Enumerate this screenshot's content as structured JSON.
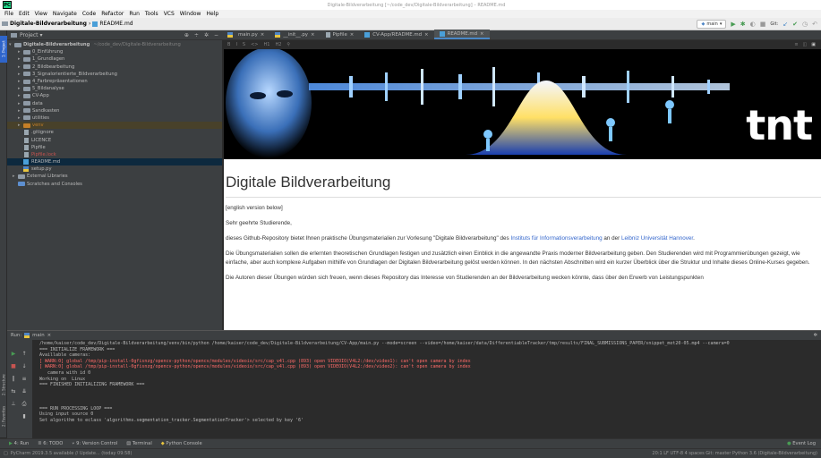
{
  "window": {
    "title": "Digitale-Bildverarbeitung [~/code_dev/Digitale-Bildverarbeitung] – README.md"
  },
  "menu": [
    "File",
    "Edit",
    "View",
    "Navigate",
    "Code",
    "Refactor",
    "Run",
    "Tools",
    "VCS",
    "Window",
    "Help"
  ],
  "nav": {
    "project": "Digitale-Bildverarbeitung",
    "file": "README.md",
    "branch": "main",
    "git_label": "Git:"
  },
  "project_panel": {
    "title": "Project",
    "root": "Digitale-Bildverarbeitung",
    "root_path": "~/code_dev/Digitale-Bildverarbeitung",
    "items": [
      "0_Einführung",
      "1_Grundlagen",
      "2_Bildbearbeitung",
      "3_Signalorientierte_Bildverarbeitung",
      "4_Farbrepräsentationen",
      "5_Bildanalyse",
      "CV-App",
      "data",
      "Sandkasten",
      "utilities",
      "venv",
      ".gitignore",
      "LICENCE",
      "Pipfile",
      "Pipfile.lock",
      "README.md",
      "setup.py",
      "External Libraries",
      "Scratches and Consoles"
    ]
  },
  "tabs": [
    "main.py",
    "__init__.py",
    "Pipfile",
    "CV-App/README.md",
    "README.md"
  ],
  "mdtools": [
    "B",
    "I",
    "S",
    "<>",
    "H1",
    "H2"
  ],
  "sidebar_tabs": [
    "1: Project",
    "2: Structure",
    "2: Favorites"
  ],
  "readme": {
    "heading": "Digitale Bildverarbeitung",
    "p1": "[english version below]",
    "p2": "Sehr geehrte Studierende,",
    "p3a": "dieses Github-Repository bietet Ihnen praktische Übungsmaterialien zur Vorlesung \"Digitale Bildverarbeitung\" des ",
    "p3link1": "Instituts für Informationsverarbeitung",
    "p3b": " an der ",
    "p3link2": "Leibniz Universität Hannover",
    "p3c": ".",
    "p4": "Die Übungsmaterialien sollen die erlernten theoretischen Grundlagen festigen und zusätzlich einen Einblick in die angewandte Praxis moderner Bildverarbeitung geben. Den Studierenden wird mit Programmierübungen gezeigt, wie einfache, aber auch komplexe Aufgaben mithilfe von Grundlagen der Digitalen Bildverarbeitung gelöst werden können. In den nächsten Abschnitten wird ein kurzer Überblick über die Struktur und Inhalte dieses Online-Kurses gegeben.",
    "p5": "Die Autoren dieser Übungen würden sich freuen, wenn dieses Repository das Interesse von Studierenden an der Bildverarbeitung wecken könnte, dass über den Erwerb von Leistungspunkten",
    "banner_logo": "tnt"
  },
  "run": {
    "label": "Run:",
    "config": "main",
    "lines": [
      {
        "t": "/home/kaiser/code_dev/Digitale-Bildverarbeitung/venv/bin/python /home/kaiser/code_dev/Digitale-Bildverarbeitung/CV-App/main.py --mode=screen --video=/home/kaiser/data/DifferentiableTracker/tmp/results/FINAL_SUBMISSIONS_PAPER/snippet_mot20-05.mp4 --camera=0",
        "e": false
      },
      {
        "t": "=== INITIALIZE FRAMEWORK ===",
        "e": false
      },
      {
        "t": "Availlable cameras:",
        "e": false
      },
      {
        "t": "[ WARN:0] global /tmp/pip-install-0gfisnzg/opencv-python/opencv/modules/videoio/src/cap_v4l.cpp (893) open VIDEOIO(V4L2:/dev/video1): can't open camera by index",
        "e": true
      },
      {
        "t": "[ WARN:0] global /tmp/pip-install-0gfisnzg/opencv-python/opencv/modules/videoio/src/cap_v4l.cpp (893) open VIDEOIO(V4L2:/dev/video2): can't open camera by index",
        "e": true
      },
      {
        "t": "   camera with id 0",
        "e": false
      },
      {
        "t": "Working on  Linux",
        "e": false
      },
      {
        "t": "=== FINISHED INITIALIZING FRAMEWORK ===",
        "e": false
      },
      {
        "t": "",
        "e": false
      },
      {
        "t": "",
        "e": false
      },
      {
        "t": "",
        "e": false
      },
      {
        "t": "=== RUN PROCESSING LOOP ===",
        "e": false
      },
      {
        "t": "Using input source 0",
        "e": false
      },
      {
        "t": "Set algorithm to eclass 'algorithms.segmentation_tracker.SegmentationTracker'> selected by key '6'",
        "e": false
      }
    ]
  },
  "bottom_tools": [
    "4: Run",
    "6: TODO",
    "9: Version Control",
    "Terminal",
    "Python Console"
  ],
  "event_log": "Event Log",
  "status": {
    "left": "PyCharm 2019.3.5 available // Update... (today 09:58)",
    "right": "20:1   LF   UTF-8   4 spaces   Git: master   Python 3.6 (Digitale-Bildverarbeitung)"
  },
  "colors": {
    "bg": "#2b2b2b",
    "panel": "#3c3f41",
    "selection": "#0d293e",
    "error": "#ff6b68",
    "link": "#3366cc"
  }
}
